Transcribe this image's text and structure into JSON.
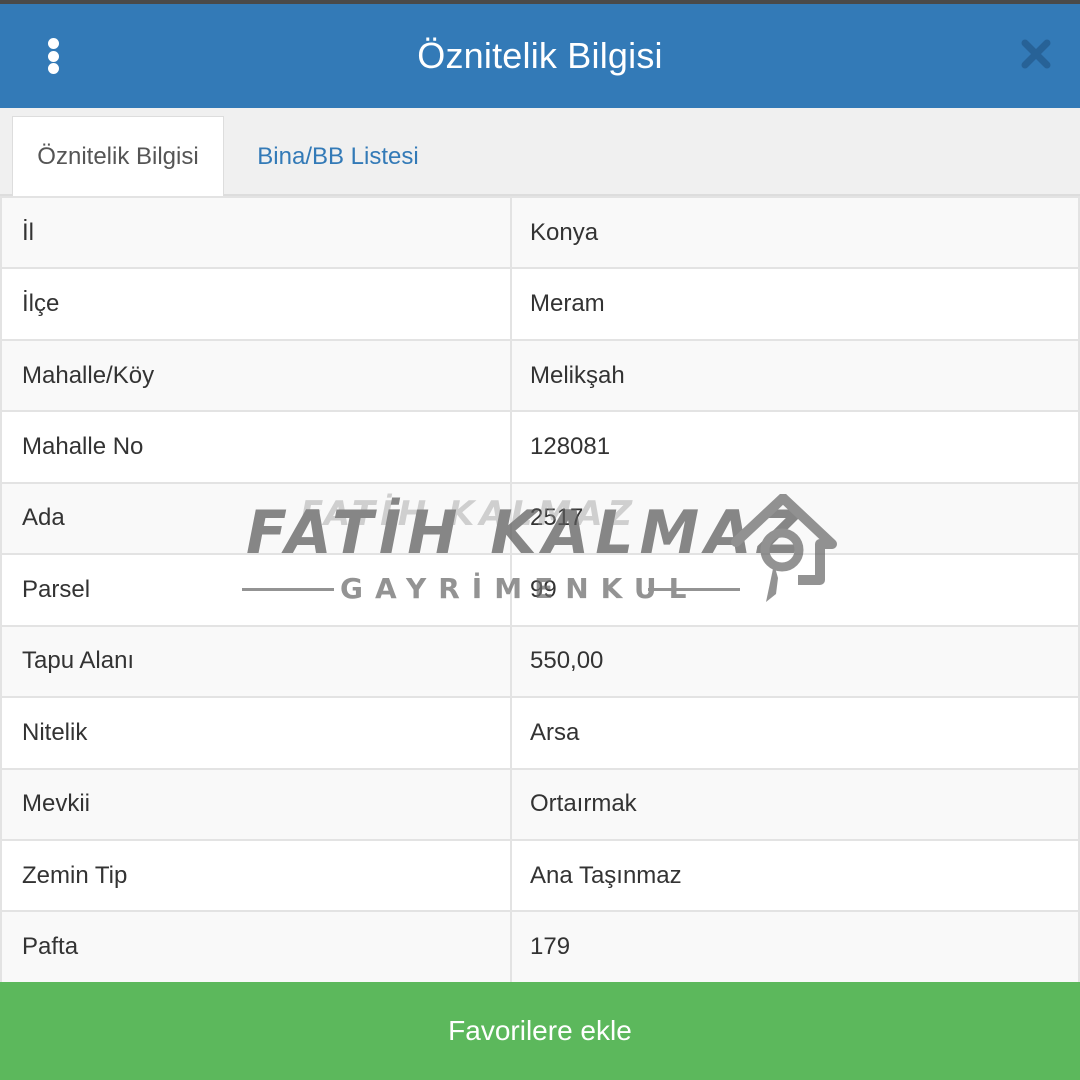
{
  "header": {
    "title": "Öznitelik Bilgisi",
    "menu_icon": "vertical-dots-icon",
    "close_icon": "close-icon"
  },
  "tabs": [
    {
      "label": "Öznitelik Bilgisi",
      "active": true
    },
    {
      "label": "Bina/BB Listesi",
      "active": false
    }
  ],
  "attributes": [
    {
      "key": "İl",
      "value": "Konya"
    },
    {
      "key": "İlçe",
      "value": "Meram"
    },
    {
      "key": "Mahalle/Köy",
      "value": "Melikşah"
    },
    {
      "key": "Mahalle No",
      "value": "128081"
    },
    {
      "key": "Ada",
      "value": "2517"
    },
    {
      "key": "Parsel",
      "value": "99"
    },
    {
      "key": "Tapu Alanı",
      "value": "550,00"
    },
    {
      "key": "Nitelik",
      "value": "Arsa"
    },
    {
      "key": "Mevkii",
      "value": "Ortaırmak"
    },
    {
      "key": "Zemin Tip",
      "value": "Ana Taşınmaz"
    },
    {
      "key": "Pafta",
      "value": "179"
    }
  ],
  "watermark": {
    "name": "FATİH KALMAZ",
    "subtitle": "GAYRİMENKUL",
    "logo_icon": "house-key-icon"
  },
  "footer": {
    "button_label": "Favorilere ekle"
  },
  "colors": {
    "header": "#337ab7",
    "tab_link": "#337ab7",
    "footer_button": "#5cb85c"
  }
}
